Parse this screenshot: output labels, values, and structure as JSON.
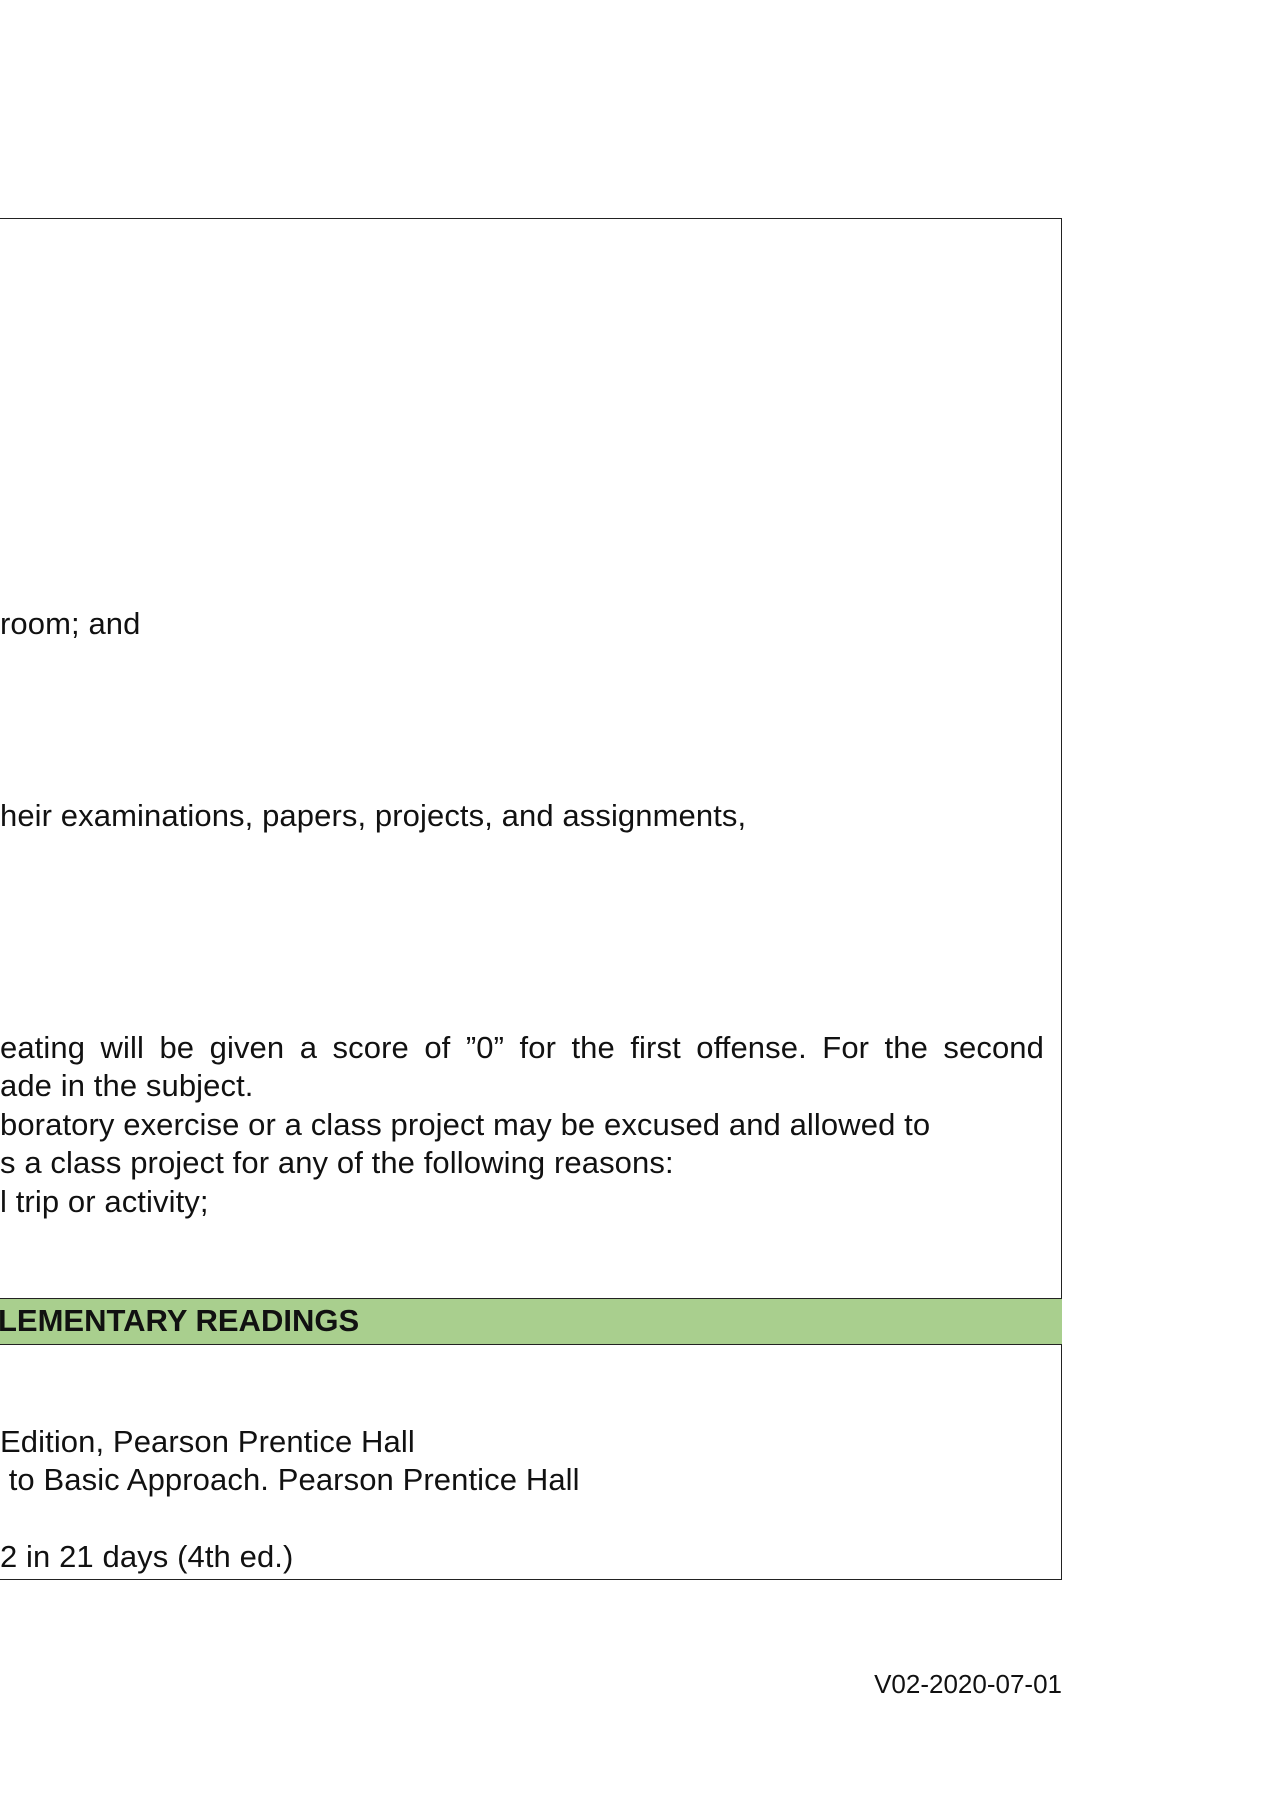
{
  "policies": {
    "line_1": "room; and",
    "line_2": "heir examinations, papers, projects, and assignments,",
    "line_3": "eating will be given a score of ”0” for the first offense. For the second",
    "line_4": "ade in the subject.",
    "line_5": "boratory exercise or a class project may be excused and allowed to",
    "line_6": "s a class project for any of the following reasons:",
    "line_7": "l trip or activity;"
  },
  "readings_section": {
    "heading": "LEMENTARY READINGS",
    "line_1": "Edition, Pearson Prentice Hall",
    "line_2": " to Basic Approach. Pearson Prentice Hall",
    "line_3": "2 in 21 days (4th ed.)"
  },
  "footer": {
    "version": "V02-2020-07-01"
  }
}
